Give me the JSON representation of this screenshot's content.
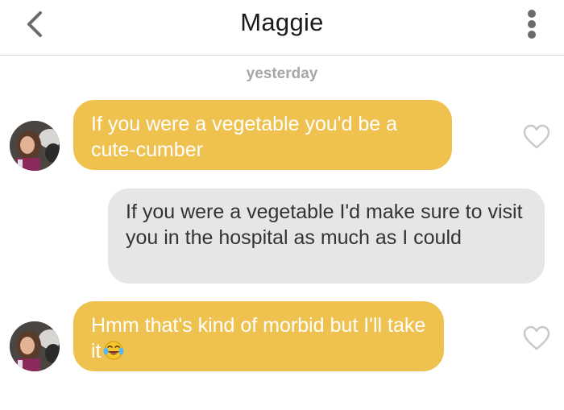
{
  "header": {
    "title": "Maggie",
    "back_icon": "chevron-left-icon",
    "menu_icon": "more-vertical-icon"
  },
  "conversation": {
    "date_label": "yesterday",
    "messages": [
      {
        "direction": "incoming",
        "text": "If you were a vegetable you'd be a cute-cumber",
        "liked": false
      },
      {
        "direction": "outgoing",
        "text": "If you were a vegetable I'd make sure to visit you in the hospital as much as I could"
      },
      {
        "direction": "incoming",
        "text": "Hmm that's kind of morbid but I'll take it",
        "emoji": "laughing-tears-emoji",
        "liked": false
      }
    ]
  },
  "colors": {
    "incoming_bubble": "#efc24f",
    "outgoing_bubble": "#e6e6e6",
    "date_label": "#a7a7a7",
    "heart_outline": "#c9c9c9"
  }
}
